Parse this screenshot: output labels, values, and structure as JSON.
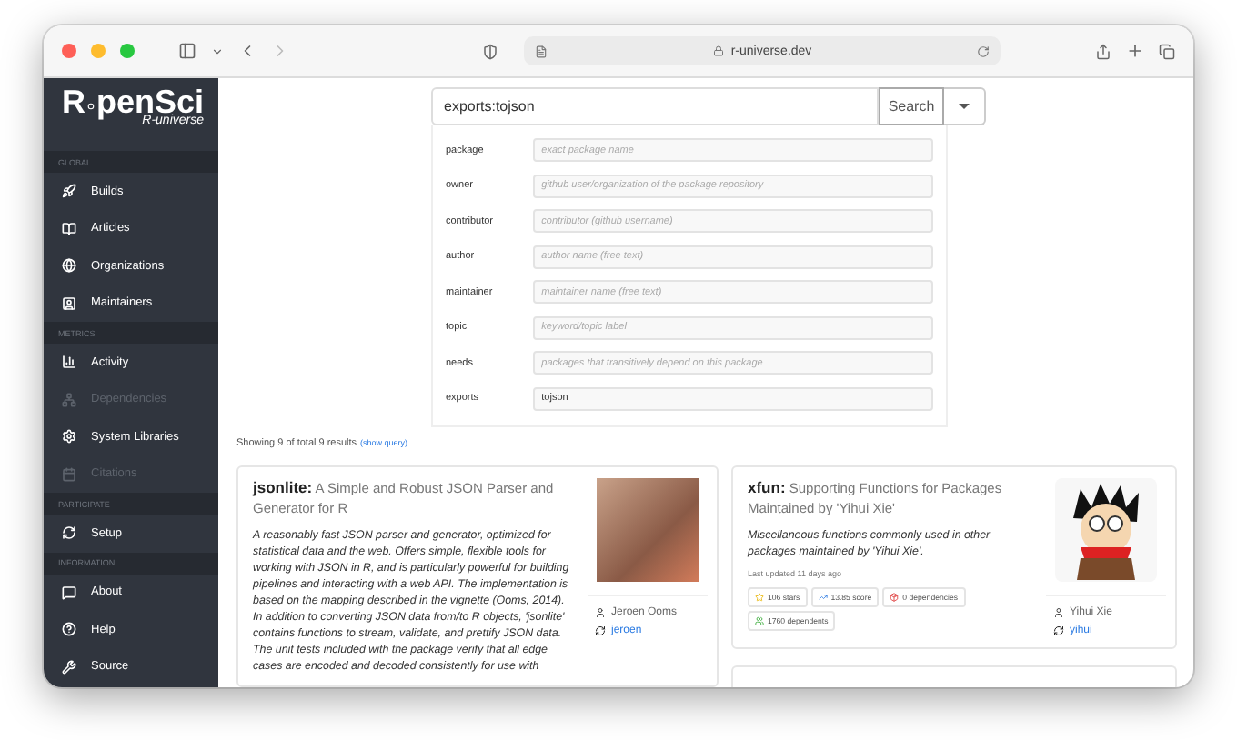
{
  "browser": {
    "url": "r-universe.dev"
  },
  "sidebar": {
    "logo": {
      "left": "R",
      "right": "penSci",
      "subtitle": "R-universe"
    },
    "sections": [
      {
        "heading": "GLOBAL",
        "items": [
          {
            "label": "Builds",
            "disabled": false
          },
          {
            "label": "Articles",
            "disabled": false
          },
          {
            "label": "Organizations",
            "disabled": false
          },
          {
            "label": "Maintainers",
            "disabled": false
          }
        ]
      },
      {
        "heading": "METRICS",
        "items": [
          {
            "label": "Activity",
            "disabled": false
          },
          {
            "label": "Dependencies",
            "disabled": true
          },
          {
            "label": "System Libraries",
            "disabled": false
          },
          {
            "label": "Citations",
            "disabled": true
          }
        ]
      },
      {
        "heading": "PARTICIPATE",
        "items": [
          {
            "label": "Setup",
            "disabled": false
          }
        ]
      },
      {
        "heading": "INFORMATION",
        "items": [
          {
            "label": "About",
            "disabled": false
          },
          {
            "label": "Help",
            "disabled": false
          },
          {
            "label": "Source",
            "disabled": false
          }
        ]
      }
    ]
  },
  "search": {
    "value": "exports:tojson",
    "button": "Search",
    "fields": [
      {
        "label": "package",
        "placeholder": "exact package name"
      },
      {
        "label": "owner",
        "placeholder": "github user/organization of the package repository"
      },
      {
        "label": "contributor",
        "placeholder": "contributor (github username)"
      },
      {
        "label": "author",
        "placeholder": "author name (free text)"
      },
      {
        "label": "maintainer",
        "placeholder": "maintainer name (free text)"
      },
      {
        "label": "topic",
        "placeholder": "keyword/topic label"
      },
      {
        "label": "needs",
        "placeholder": "packages that transitively depend on this package"
      },
      {
        "label": "exports",
        "value": "tojson"
      }
    ]
  },
  "results": {
    "summary": "Showing 9 of total 9 results",
    "link": "(show query)",
    "cards": [
      {
        "kind": "photo",
        "name": "jsonlite:",
        "title": "A Simple and Robust JSON Parser and Generator for R",
        "description": "A reasonably fast JSON parser and generator, optimized for statistical data and the web. Offers simple, flexible tools for working with JSON in R, and is particularly powerful for building pipelines and interacting with a web API. The implementation is based on the mapping described in the vignette (Ooms, 2014). In addition to converting JSON data from/to R objects, 'jsonlite' contains functions to stream, validate, and prettify JSON data. The unit tests included with the package verify that all edge cases are encoded and decoded consistently for use with",
        "maintainer": "Jeroen Ooms",
        "handle": "jeroen"
      },
      {
        "kind": "cartoon",
        "name": "xfun:",
        "title": "Supporting Functions for Packages Maintained by 'Yihui Xie'",
        "description": "Miscellaneous functions commonly used in other packages maintained by 'Yihui Xie'.",
        "updated": "Last updated 11 days ago",
        "badges": [
          "106 stars",
          "13.85 score",
          "0 dependencies",
          "1760 dependents"
        ],
        "maintainer": "Yihui Xie",
        "handle": "yihui"
      }
    ]
  }
}
